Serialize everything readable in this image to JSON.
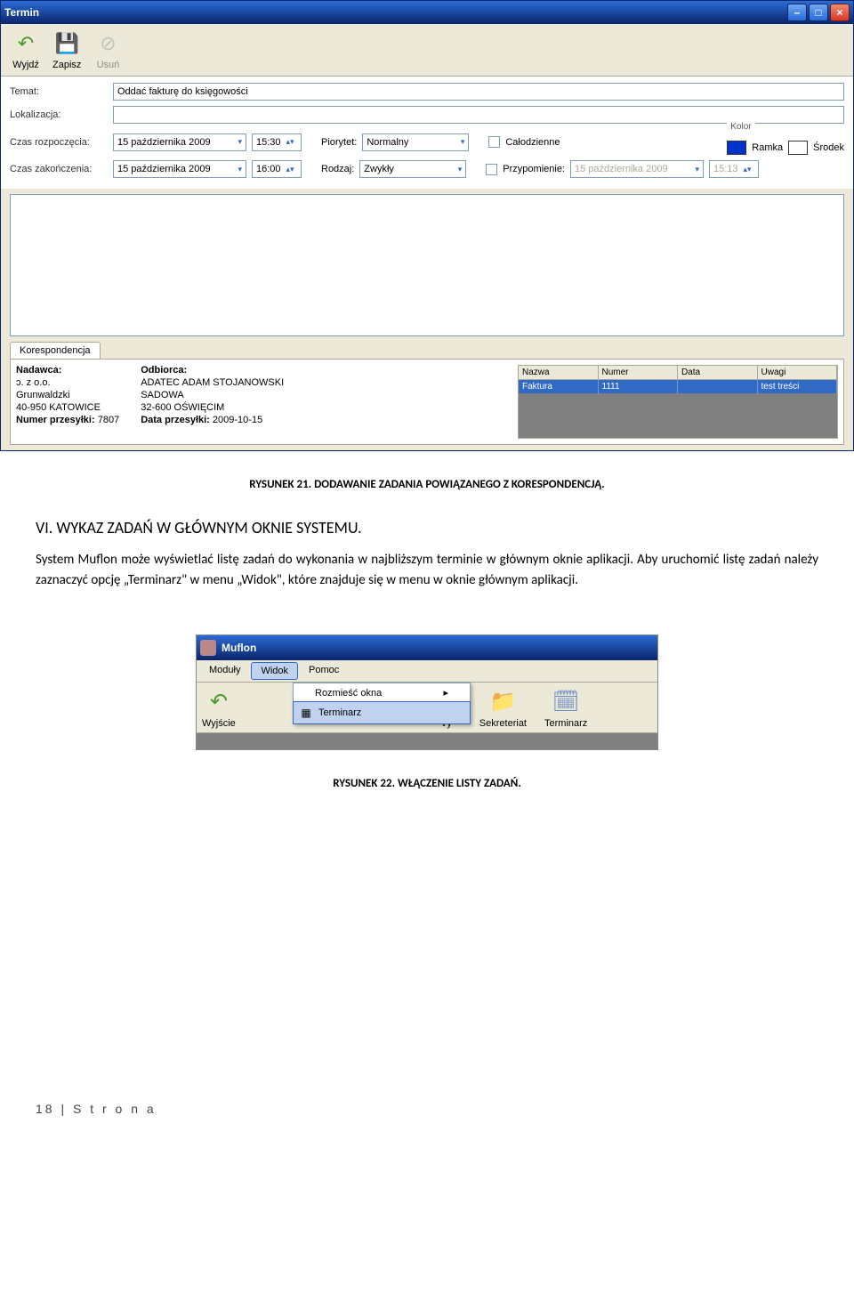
{
  "window1": {
    "title": "Termin",
    "toolbar": {
      "exit": "Wyjdź",
      "save": "Zapisz",
      "delete": "Usuń"
    },
    "form": {
      "subject_label": "Temat:",
      "subject_value": "Oddać fakturę do księgowości",
      "location_label": "Lokalizacja:",
      "location_value": "",
      "start_label": "Czas rozpoczęcia:",
      "start_date": "15 października 2009",
      "start_time": "15:30",
      "priority_label": "Piorytet:",
      "priority_value": "Normalny",
      "allday_label": "Całodzienne",
      "color_label": "Kolor",
      "frame_label": "Ramka",
      "center_label": "Środek",
      "end_label": "Czas zakończenia:",
      "end_date": "15 października 2009",
      "end_time": "16:00",
      "type_label": "Rodzaj:",
      "type_value": "Zwykły",
      "reminder_label": "Przypomienie:",
      "reminder_date": "15 października 2009",
      "reminder_time": "15:13"
    },
    "tab_label": "Korespondencja",
    "kor": {
      "sender_label": "Nadawca:",
      "sender_name": "ɔ. z o.o.",
      "sender_street": "Grunwaldzki",
      "sender_city": "40-950 KATOWICE",
      "recipient_label": "Odbiorca:",
      "recipient_name": "ADATEC ADAM STOJANOWSKI",
      "recipient_street": "SADOWA",
      "recipient_city": "32-600 OŚWIĘCIM",
      "shipment_no_label": "Numer przesyłki:",
      "shipment_no_value": "7807",
      "shipment_date_label": "Data przesyłki:",
      "shipment_date_value": "2009-10-15",
      "table": {
        "headers": [
          "Nazwa",
          "Numer",
          "Data",
          "Uwagi"
        ],
        "row": [
          "Faktura",
          "1111",
          "",
          "test treści"
        ]
      }
    }
  },
  "caption1": "RYSUNEK 21. DODAWANIE ZADANIA POWIĄZANEGO Z KORESPONDENCJĄ.",
  "section_num": "VI.",
  "section_title": "WYKAZ ZADAŃ W GŁÓWNYM OKNIE SYSTEMU.",
  "paragraph": "System Muflon może wyświetlać listę zadań do wykonania w najbliższym terminie w głównym oknie aplikacji. Aby uruchomić listę zadań należy zaznaczyć opcję „Terminarz\" w menu „Widok\", które znajduje się w menu w oknie głównym aplikacji.",
  "window2": {
    "title": "Muflon",
    "menus": [
      "Moduły",
      "Widok",
      "Pomoc"
    ],
    "dropdown_items": [
      "Rozmieść okna",
      "Terminarz"
    ],
    "buttons": {
      "exit": "Wyjście",
      "sekr": "Sekreteriat",
      "term": "Terminarz",
      "partial": "ɤy"
    }
  },
  "caption2": "RYSUNEK 22. WŁĄCZENIE LISTY ZADAŃ.",
  "footer": "18 | S t r o n a"
}
